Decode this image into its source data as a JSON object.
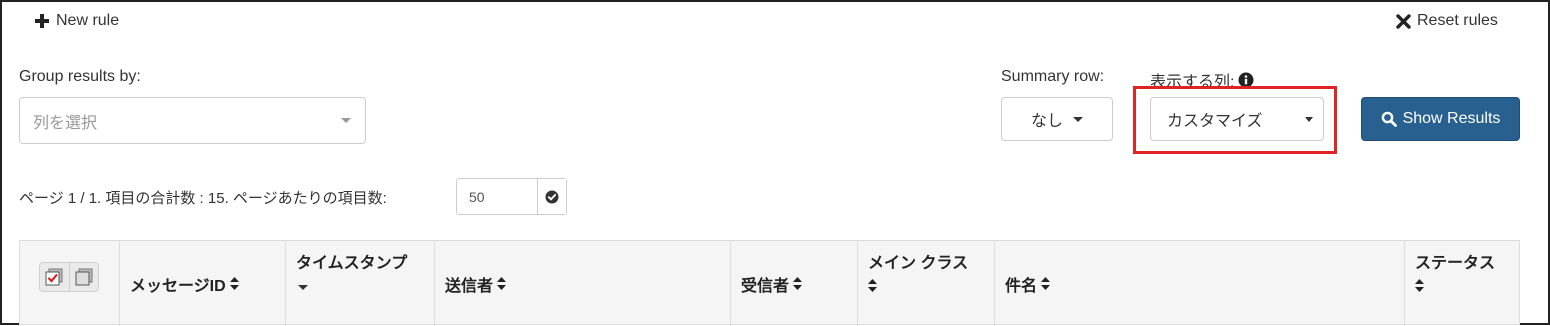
{
  "toolbar": {
    "new_rule_label": "New rule",
    "reset_rules_label": "Reset rules"
  },
  "group_by": {
    "label": "Group results by:",
    "placeholder": "列を選択"
  },
  "summary_row": {
    "label": "Summary row:",
    "value": "なし"
  },
  "display_columns": {
    "label": "表示する列:",
    "value": "カスタマイズ",
    "info_icon": "info-circle-icon"
  },
  "show_results_label": "Show Results",
  "pagination": {
    "text": "ページ 1 / 1. 項目の合計数 : 15. ページあたりの項目数:",
    "per_page_value": "50"
  },
  "table": {
    "headers": [
      {
        "label": "メッセージID"
      },
      {
        "label": "タイムスタンプ"
      },
      {
        "label": "送信者"
      },
      {
        "label": "受信者"
      },
      {
        "label": "メイン クラス"
      },
      {
        "label": "件名"
      },
      {
        "label": "ステータス"
      }
    ]
  },
  "colors": {
    "primary": "#286090",
    "highlight": "#e02424",
    "header_bg": "#f5f5f5"
  }
}
